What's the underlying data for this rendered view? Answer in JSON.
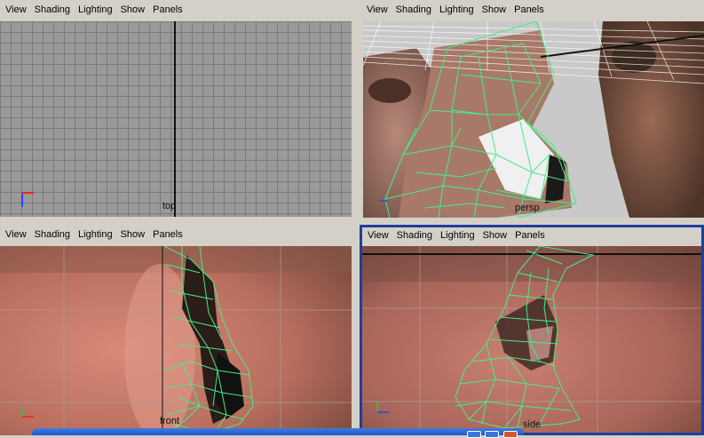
{
  "menu": [
    "View",
    "Shading",
    "Lighting",
    "Show",
    "Panels"
  ],
  "panels": {
    "top": {
      "camera_label": "top"
    },
    "persp": {
      "camera_label": "persp"
    },
    "front": {
      "camera_label": "front"
    },
    "side": {
      "camera_label": "side"
    }
  },
  "colors": {
    "wireframe": "#44ee88",
    "grid_bg": "#9a9a9a",
    "active_border": "#1e3f9e"
  }
}
